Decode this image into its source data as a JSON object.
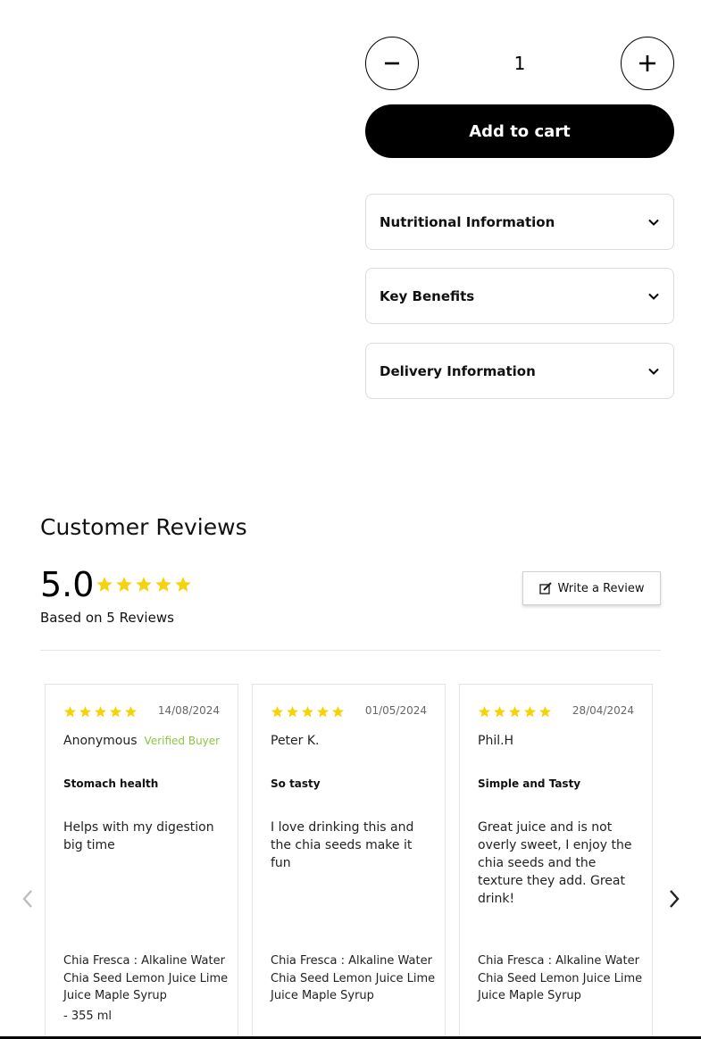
{
  "product": {
    "quantity": "1",
    "add_to_cart_label": "Add to cart",
    "accordions": [
      {
        "label": "Nutritional Information"
      },
      {
        "label": "Key Benefits"
      },
      {
        "label": "Delivery Information"
      }
    ],
    "icons": {
      "decrease": "minus-icon",
      "increase": "plus-icon",
      "expand": "chevron-down-icon"
    }
  },
  "reviews": {
    "title": "Customer Reviews",
    "average": "5.0",
    "average_rating": 5,
    "based_on": "Based on 5 Reviews",
    "write_review_label": "Write a Review",
    "star_color": "#f6d20a",
    "verified_color": "#8cc63f",
    "items": [
      {
        "rating": 5,
        "date": "14/08/2024",
        "author": "Anonymous",
        "badge": "Verified Buyer",
        "title": "Stomach health",
        "body": "Helps with my digestion big time",
        "product": "Chia Fresca : Alkaline Water Chia Seed Lemon Juice Lime Juice Maple Syrup",
        "variant": "- 355 ml"
      },
      {
        "rating": 5,
        "date": "01/05/2024",
        "author": "Peter K.",
        "title": "So tasty",
        "body": "I love drinking this and the chia seeds make it fun",
        "product": "Chia Fresca : Alkaline Water Chia Seed Lemon Juice Lime Juice Maple Syrup"
      },
      {
        "rating": 5,
        "date": "28/04/2024",
        "author": "Phil.H",
        "title": "Simple and Tasty",
        "body": "Great juice and is not overly sweet, I enjoy the chia seeds and the texture they add. Great drink!",
        "product": "Chia Fresca : Alkaline Water Chia Seed Lemon Juice Lime Juice Maple Syrup"
      }
    ]
  }
}
